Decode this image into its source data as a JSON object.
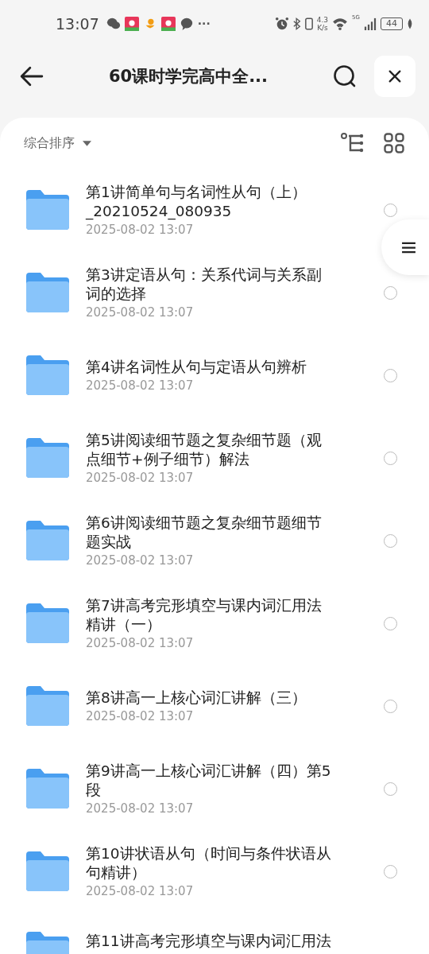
{
  "status_bar": {
    "time": "13:07",
    "more": "···",
    "speed": "4.3\nK/s",
    "network": "5G",
    "battery": "44"
  },
  "header": {
    "title": "60课时学完高中全..."
  },
  "toolbar": {
    "sort_label": "综合排序"
  },
  "files": [
    {
      "name": "第1讲简单句与名词性从句（上）_20210524_080935",
      "date": "2025-08-02 13:07",
      "selected": false
    },
    {
      "name": "第3讲定语从句：关系代词与关系副词的选择",
      "date": "2025-08-02 13:07",
      "selected": false
    },
    {
      "name": "第4讲名词性从句与定语从句辨析",
      "date": "2025-08-02 13:07",
      "selected": false
    },
    {
      "name": "第5讲阅读细节题之复杂细节题（观点细节+例子细节）解法",
      "date": "2025-08-02 13:07",
      "selected": false
    },
    {
      "name": "第6讲阅读细节题之复杂细节题细节题实战",
      "date": "2025-08-02 13:07",
      "selected": false
    },
    {
      "name": "第7讲高考完形填空与课内词汇用法精讲（一）",
      "date": "2025-08-02 13:07",
      "selected": false
    },
    {
      "name": "第8讲高一上核心词汇讲解（三）",
      "date": "2025-08-02 13:07",
      "selected": false
    },
    {
      "name": "第9讲高一上核心词汇讲解（四）第5段",
      "date": "2025-08-02 13:07",
      "selected": false
    },
    {
      "name": "第10讲状语从句（时间与条件状语从句精讲）",
      "date": "2025-08-02 13:07",
      "selected": false
    },
    {
      "name": "第11讲高考完形填空与课内词汇用法"
    }
  ]
}
